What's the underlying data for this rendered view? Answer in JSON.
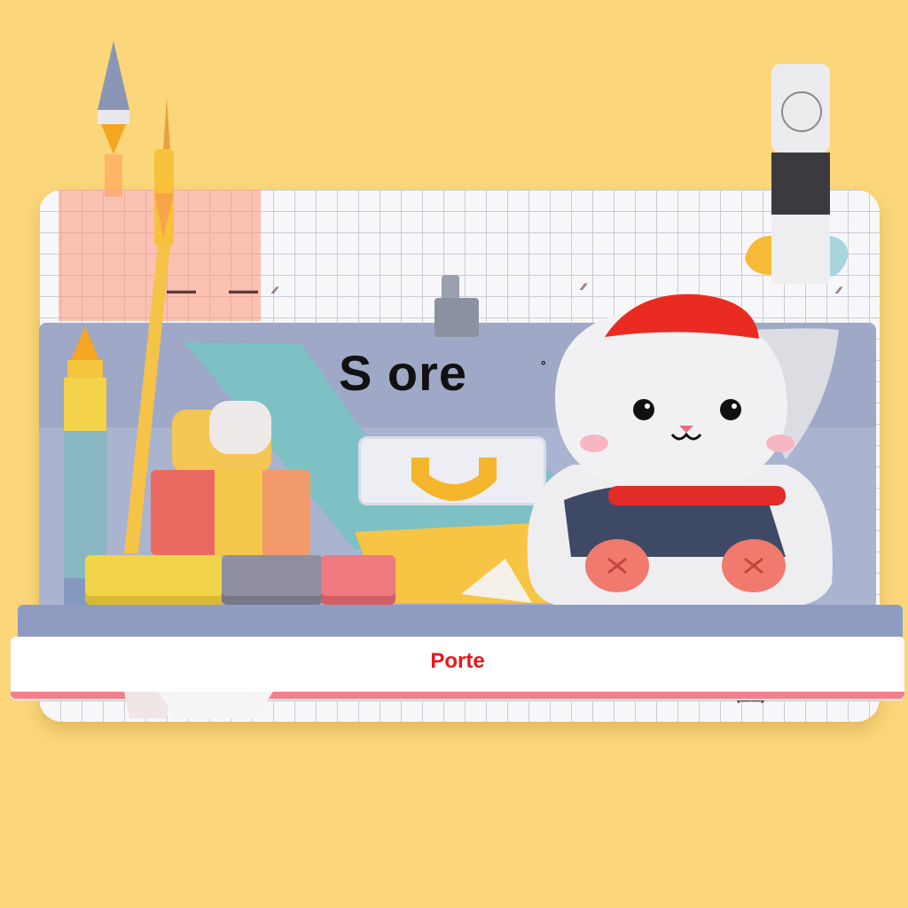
{
  "sign_text": "S ore",
  "label_text": "Porte",
  "colors": {
    "background": "#fbd67a",
    "board": "#f7f7fa",
    "band": "#9fa8c6",
    "label": "#e8171a",
    "strip_edge": "#f2808a"
  },
  "icons": [
    "pencil-icon",
    "pen-icon",
    "highlighter-icon",
    "cat-mascot",
    "clip-icon",
    "eraser-icon"
  ]
}
